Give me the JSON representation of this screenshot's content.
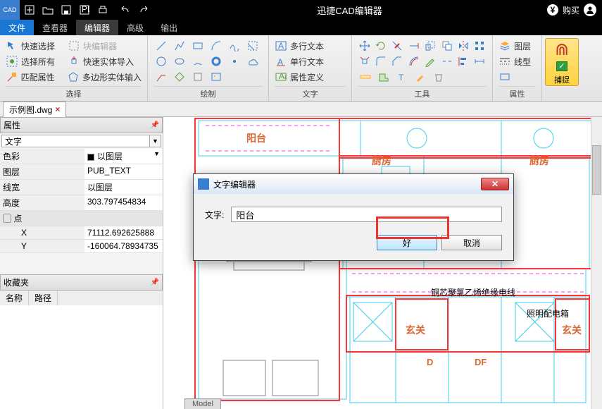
{
  "app": {
    "title": "迅捷CAD编辑器",
    "logo": "CAD",
    "buy": "购买"
  },
  "menu": {
    "file": "文件",
    "viewer": "查看器",
    "editor": "编辑器",
    "advanced": "高级",
    "output": "输出"
  },
  "ribbon": {
    "group_select": {
      "label": "选择",
      "quick_select": "快速选择",
      "select_all": "选择所有",
      "match_props": "匹配属性",
      "block_editor": "块编辑器",
      "quick_entity_import": "快速实体导入",
      "polygon_entity_input": "多边形实体输入"
    },
    "group_draw": {
      "label": "绘制"
    },
    "group_text": {
      "label": "文字",
      "mtext": "多行文本",
      "stext": "单行文本",
      "attrdef": "属性定义"
    },
    "group_tool": {
      "label": "工具"
    },
    "group_props": {
      "label": "属性",
      "layers": "图层",
      "linetype": "线型"
    },
    "capture": "捕捉"
  },
  "doctab": {
    "name": "示例图.dwg"
  },
  "panel": {
    "props_title": "属性",
    "selector_value": "文字",
    "rows": {
      "color_k": "色彩",
      "color_v": "以图层",
      "layer_k": "图层",
      "layer_v": "PUB_TEXT",
      "lw_k": "线宽",
      "lw_v": "以图层",
      "height_k": "高度",
      "height_v": "303.797454834",
      "point_hdr": "点",
      "x_k": "X",
      "x_v": "71112.692625888",
      "y_k": "Y",
      "y_v": "-160064.78934735"
    },
    "fav_title": "收藏夹",
    "fav_cols": {
      "name": "名称",
      "path": "路径"
    }
  },
  "canvas": {
    "balcony": "阳台",
    "kitchen": "厨房",
    "entrance": "玄关",
    "wire_label": "铜芯聚氯乙烯绝缘电线",
    "lighting_box": "照明配电箱",
    "D": "D",
    "DF": "DF",
    "model_tab": "Model"
  },
  "dialog": {
    "title": "文字编辑器",
    "field_label": "文字:",
    "field_value": "阳台",
    "ok": "好",
    "cancel": "取消"
  }
}
